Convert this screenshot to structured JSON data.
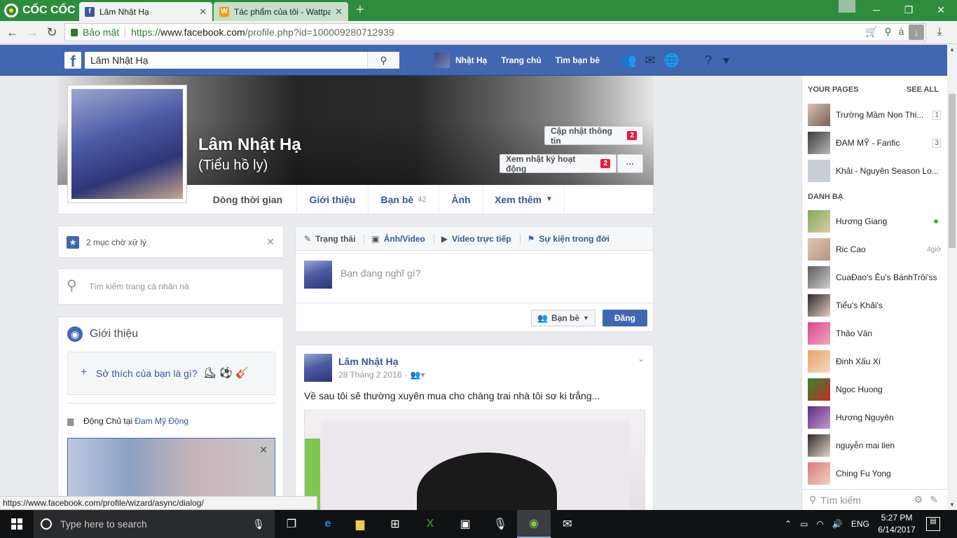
{
  "browser": {
    "brand": "CỐC CỐC",
    "tabs": [
      {
        "title": "Lâm Nhật Hạ",
        "icon": "facebook-favicon",
        "color": "#3b5998"
      },
      {
        "title": "Tác phẩm của tôi - Wattpa",
        "icon": "wattpad-favicon",
        "color": "#f39c12"
      }
    ],
    "secure_label": "Bảo mật",
    "url_proto": "https://",
    "url_host": "www.facebook.com",
    "url_path": "/profile.php?id=100009280712939",
    "status_url": "https://www.facebook.com/profile/wizard/async/dialog/"
  },
  "fb": {
    "search_value": "Lâm Nhật Hạ",
    "nav": {
      "profile": "Nhật Hạ",
      "home": "Trang chủ",
      "find_friends": "Tìm bạn bè"
    },
    "brand_color": "#4267b2"
  },
  "profile": {
    "name": "Lâm Nhật Hạ",
    "alt_name": "(Tiểu hồ ly)",
    "update_info": "Cập nhật thông tin",
    "update_info_badge": "2",
    "activity_log": "Xem nhật ký hoạt động",
    "activity_log_badge": "2",
    "more_dots": "···",
    "tabs": {
      "timeline": "Dòng thời gian",
      "about": "Giới thiệu",
      "friends": "Bạn bè",
      "friends_count": "42",
      "photos": "Ảnh",
      "more": "Xem thêm"
    }
  },
  "left": {
    "pending": "2 mục chờ xử lý",
    "search_placeholder": "Tìm kiếm trang cá nhân nà",
    "intro_title": "Giới thiệu",
    "hobbies_prompt": "Sở thích của bạn là gì?",
    "work_prefix": "Động Chủ tại",
    "work_place": "Đam Mỹ Động"
  },
  "composer": {
    "tab_status": "Trạng thái",
    "tab_photo": "Ảnh/Video",
    "tab_live": "Video trực tiếp",
    "tab_event": "Sự kiện trong đời",
    "placeholder": "Bạn đang nghĩ gì?",
    "audience": "Bạn bè",
    "post_button": "Đăng"
  },
  "post": {
    "author": "Lâm Nhật Hạ",
    "date": "28 Tháng 2 2016",
    "text": "Về sau tôi sẽ thường xuyên mua cho chàng trai nhà tôi sơ ki trắng..."
  },
  "sidebar": {
    "pages_title": "YOUR PAGES",
    "see_all": "SEE ALL",
    "pages": [
      {
        "name": "Trường Mầm Non Thi...",
        "count": "1"
      },
      {
        "name": "ĐAM MỸ - Fanfic",
        "count": "3"
      },
      {
        "name": "Khải - Nguyên Season Lo..."
      }
    ],
    "contacts_title": "DANH BẠ",
    "contacts": [
      {
        "name": "Hương Giang",
        "online": true
      },
      {
        "name": "Ric Cao",
        "time": "4giờ"
      },
      {
        "name": "CuaĐao's Êu's BánhTrôi'ss"
      },
      {
        "name": "Tiểu's Khải's"
      },
      {
        "name": "Thảo Vân"
      },
      {
        "name": "Đinh Xấu Xí"
      },
      {
        "name": "Ngoc Huong"
      },
      {
        "name": "Hương Nguyên"
      },
      {
        "name": "nguyễn mai lien"
      },
      {
        "name": "Ching Fu Yong"
      }
    ],
    "search_placeholder": "Tìm kiếm"
  },
  "taskbar": {
    "search_placeholder": "Type here to search",
    "lang": "ENG",
    "time": "5:27 PM",
    "date": "6/14/2017"
  }
}
